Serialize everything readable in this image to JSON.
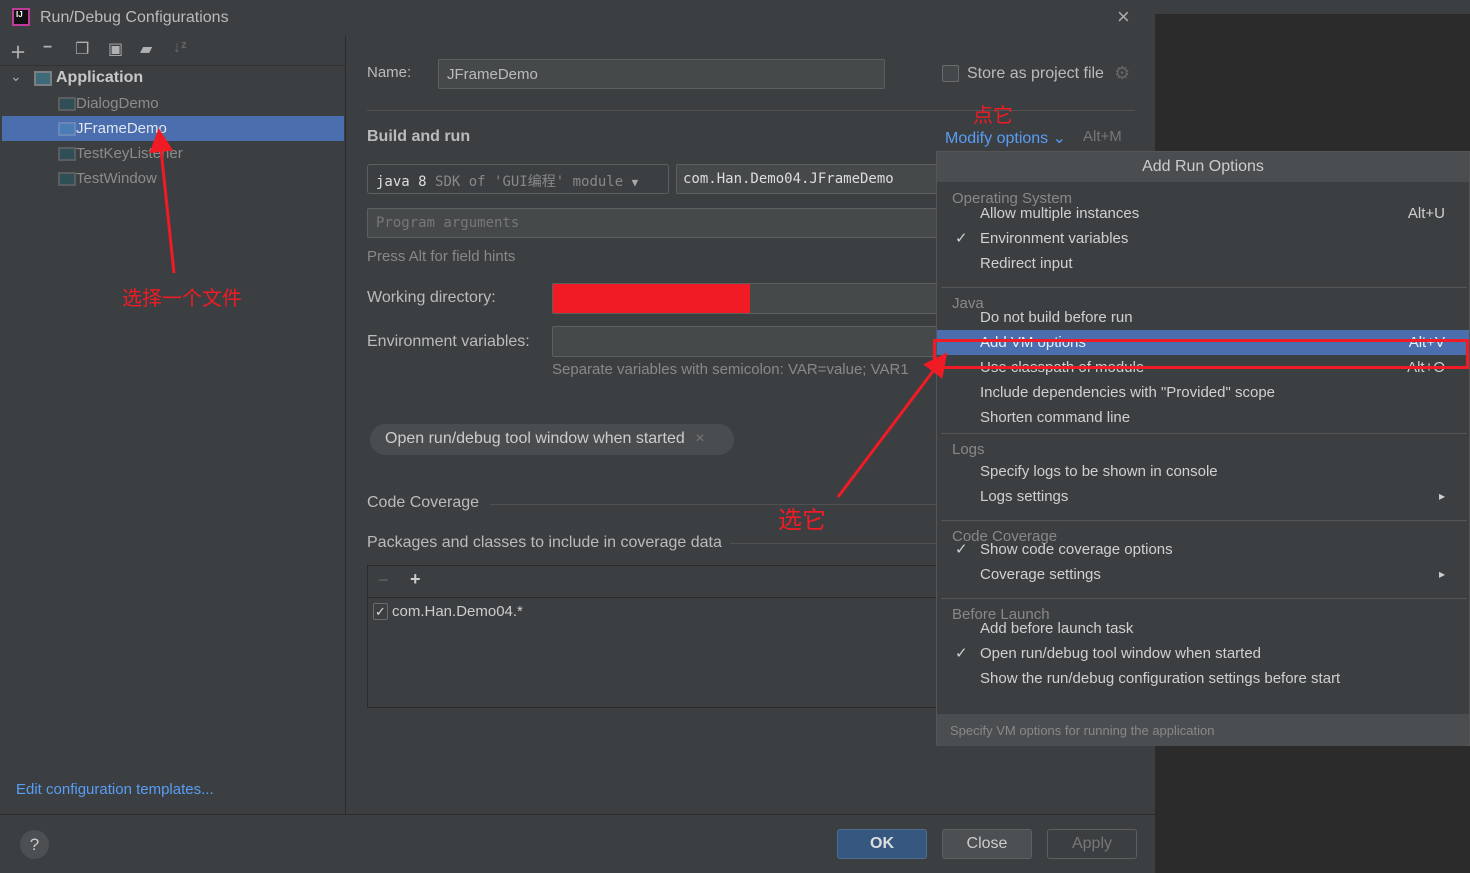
{
  "window": {
    "title": "Run/Debug Configurations",
    "close_icon": "close-icon"
  },
  "toolbar": {
    "icons": [
      "add-icon",
      "remove-icon",
      "copy-icon",
      "save-icon",
      "folder-add-icon",
      "sort-icon"
    ]
  },
  "tree": {
    "group": "Application",
    "items": [
      {
        "label": "DialogDemo"
      },
      {
        "label": "JFrameDemo",
        "selected": true
      },
      {
        "label": "TestKeyListener"
      },
      {
        "label": "TestWindow"
      }
    ]
  },
  "sidebar": {
    "edit_templates": "Edit configuration templates..."
  },
  "form": {
    "name_label": "Name:",
    "name_value": "JFrameDemo",
    "store_label": "Store as project file",
    "section_build": "Build and run",
    "modify_options": "Modify options",
    "modify_shortcut": "Alt+M",
    "sdk_java": "java 8",
    "sdk_rest": "SDK of 'GUI编程' module",
    "main_class": "com.Han.Demo04.JFrameDemo",
    "program_args_placeholder": "Program arguments",
    "hint": "Press Alt for field hints",
    "workdir_label": "Working directory:",
    "env_label": "Environment variables:",
    "env_hint": "Separate variables with semicolon: VAR=value; VAR1",
    "chip": "Open run/debug tool window when started",
    "coverage_section": "Code Coverage",
    "packages_label": "Packages and classes to include in coverage data",
    "package_item": "com.Han.Demo04.*"
  },
  "buttons": {
    "ok": "OK",
    "close": "Close",
    "apply": "Apply",
    "help": "?"
  },
  "popup": {
    "title": "Add Run Options",
    "groups": [
      {
        "header": "Operating System",
        "items": [
          {
            "label": "Allow multiple instances",
            "shortcut": "Alt+U"
          },
          {
            "label": "Environment variables",
            "checked": "✓"
          },
          {
            "label": "Redirect input"
          }
        ]
      },
      {
        "header": "Java",
        "items": [
          {
            "label": "Do not build before run"
          },
          {
            "label": "Add VM options",
            "shortcut": "Alt+V",
            "highlighted": true
          },
          {
            "label": "Use classpath of module",
            "shortcut": "Alt+O"
          },
          {
            "label": "Include dependencies with \"Provided\" scope"
          },
          {
            "label": "Shorten command line"
          }
        ]
      },
      {
        "header": "Logs",
        "items": [
          {
            "label": "Specify logs to be shown in console"
          },
          {
            "label": "Logs settings",
            "submenu": "▸"
          }
        ]
      },
      {
        "header": "Code Coverage",
        "items": [
          {
            "label": "Show code coverage options",
            "checked": "✓"
          },
          {
            "label": "Coverage settings",
            "submenu": "▸"
          }
        ]
      },
      {
        "header": "Before Launch",
        "items": [
          {
            "label": "Add before launch task"
          },
          {
            "label": "Open run/debug tool window when started",
            "checked": "✓"
          },
          {
            "label": "Show the run/debug configuration settings before start"
          }
        ]
      }
    ],
    "footer": "Specify VM options for running the application"
  },
  "annotations": {
    "click_it": "点它",
    "choose_file": "选择一个文件",
    "select_it": "选它",
    "color": "#f01b24"
  },
  "colors": {
    "selection": "#4b6eaf",
    "link": "#589df6",
    "ok": "#365880"
  }
}
